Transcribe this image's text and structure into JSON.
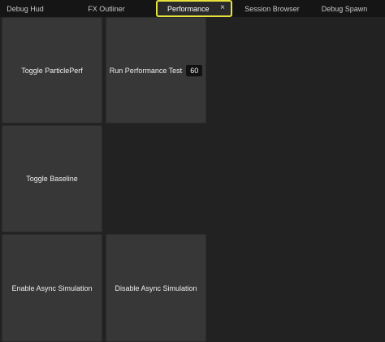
{
  "tabs": [
    {
      "label": "Debug Hud"
    },
    {
      "label": "FX Outliner"
    },
    {
      "label": "Performance",
      "active": true,
      "close_icon": "×"
    },
    {
      "label": "Session Browser"
    },
    {
      "label": "Debug Spawn"
    }
  ],
  "tiles": {
    "toggle_particle_perf": "Toggle ParticlePerf",
    "run_performance_test": "Run Performance Test",
    "run_performance_test_value": "60",
    "toggle_baseline": "Toggle Baseline",
    "enable_async_simulation": "Enable Async Simulation",
    "disable_async_simulation": "Disable Async Simulation"
  },
  "colors": {
    "accent": "#e6e13c",
    "tile_bg": "#373737",
    "panel_bg": "#222222"
  }
}
